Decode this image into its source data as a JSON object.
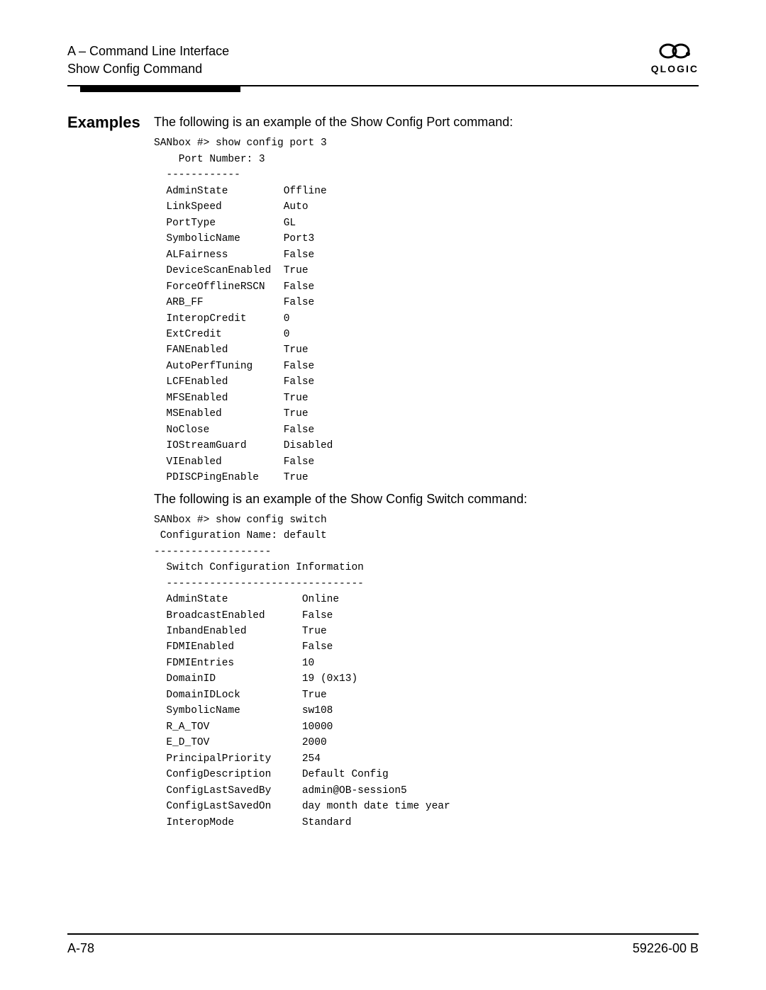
{
  "header": {
    "line1": "A – Command Line Interface",
    "line2": "Show Config Command",
    "brand": "QLOGIC"
  },
  "section_label": "Examples",
  "intro1": "The following is an example of the Show Config Port command:",
  "block1": "SANbox #> show config port 3\n    Port Number: 3\n  ------------\n  AdminState         Offline\n  LinkSpeed          Auto\n  PortType           GL\n  SymbolicName       Port3\n  ALFairness         False\n  DeviceScanEnabled  True\n  ForceOfflineRSCN   False\n  ARB_FF             False\n  InteropCredit      0\n  ExtCredit          0\n  FANEnabled         True\n  AutoPerfTuning     False\n  LCFEnabled         False\n  MFSEnabled         True\n  MSEnabled          True\n  NoClose            False\n  IOStreamGuard      Disabled\n  VIEnabled          False\n  PDISCPingEnable    True",
  "intro2": "The following is an example of the Show Config Switch command:",
  "block2": "SANbox #> show config switch\n Configuration Name: default\n-------------------\n  Switch Configuration Information\n  --------------------------------\n  AdminState            Online\n  BroadcastEnabled      False\n  InbandEnabled         True\n  FDMIEnabled           False\n  FDMIEntries           10\n  DomainID              19 (0x13)\n  DomainIDLock          True\n  SymbolicName          sw108\n  R_A_TOV               10000\n  E_D_TOV               2000\n  PrincipalPriority     254\n  ConfigDescription     Default Config\n  ConfigLastSavedBy     admin@OB-session5\n  ConfigLastSavedOn     day month date time year\n  InteropMode           Standard",
  "footer": {
    "left": "A-78",
    "right": "59226-00 B"
  }
}
